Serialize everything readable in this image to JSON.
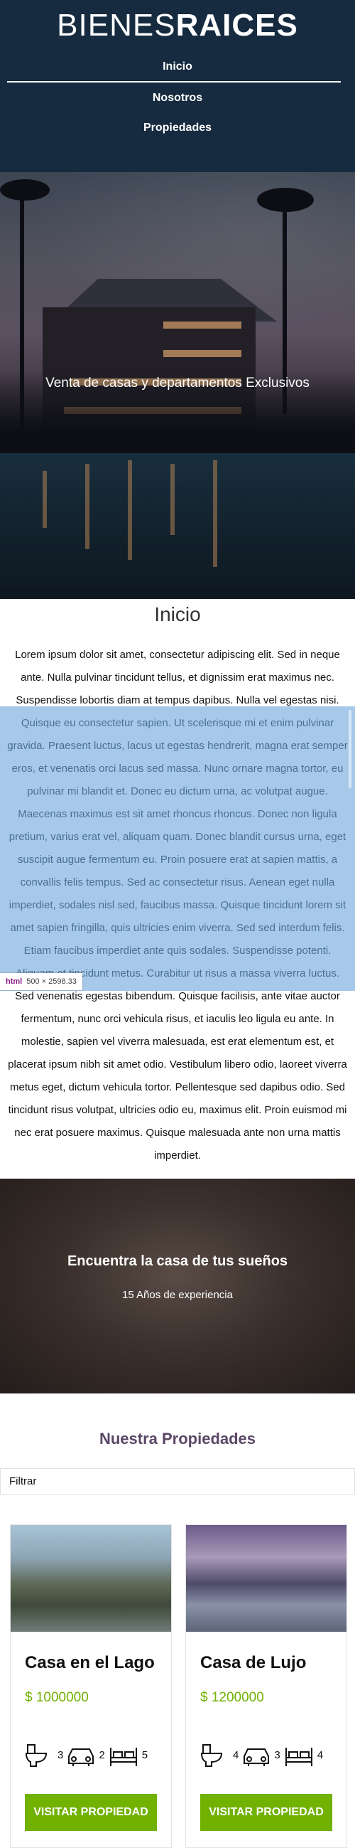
{
  "header": {
    "logo_light": "BIENES",
    "logo_bold": "RAICES",
    "nav": [
      "Inicio",
      "Nosotros",
      "Propiedades"
    ]
  },
  "hero": {
    "title": "Venta de casas y departamentos Exclusivos"
  },
  "inicio": {
    "title": "Inicio",
    "body": "Lorem ipsum dolor sit amet, consectetur adipiscing elit. Sed in neque ante. Nulla pulvinar tincidunt tellus, et dignissim erat maximus nec. Suspendisse lobortis diam at tempus dapibus. Nulla vel egestas nisi. Quisque eu consectetur sapien. Ut scelerisque mi et enim pulvinar gravida. Praesent luctus, lacus ut egestas hendrerit, magna erat semper eros, et venenatis orci lacus sed massa. Nunc ornare magna tortor, eu pulvinar mi blandit et. Donec eu dictum urna, ac volutpat augue. Maecenas maximus est sit amet rhoncus rhoncus. Donec non ligula pretium, varius erat vel, aliquam quam. Donec blandit cursus urna, eget suscipit augue fermentum eu. Proin posuere erat at sapien mattis, a convallis felis tempus. Sed ac consectetur risus. Aenean eget nulla imperdiet, sodales nisl sed, faucibus massa. Quisque tincidunt lorem sit amet sapien fringilla, quis ultricies enim viverra. Sed sed interdum felis. Etiam faucibus imperdiet ante quis sodales. Suspendisse potenti. Aliquam et tincidunt metus. Curabitur ut risus a massa viverra luctus. Sed venenatis egestas bibendum. Quisque facilisis, ante vitae auctor fermentum, nunc orci vehicula risus, et iaculis leo ligula eu ante. In molestie, sapien vel viverra malesuada, est erat elementum est, et placerat ipsum nibh sit amet odio. Vestibulum libero odio, laoreet viverra metus eget, dictum vehicula tortor. Pellentesque sed dapibus odio. Sed tincidunt risus volutpat, ultricies odio eu, maximus elit. Proin euismod mi nec erat posuere maximus. Quisque malesuada ante non urna mattis imperdiet."
  },
  "dev_badge": {
    "tag": "html",
    "size": "500 × 2598.33"
  },
  "banner": {
    "title": "Encuentra la casa de tus sueños",
    "subtitle": "15 Años de experiencia"
  },
  "properties": {
    "title": "Nuestra Propiedades",
    "filter_label": "Filtrar",
    "button_label": "VISITAR PROPIEDAD",
    "items": [
      {
        "name": "Casa en el Lago",
        "price": "$ 1000000",
        "toilets": "3",
        "parking": "2",
        "bedrooms": "5"
      },
      {
        "name": "Casa de Lujo",
        "price": "$ 1200000",
        "toilets": "4",
        "parking": "3",
        "bedrooms": "4"
      }
    ]
  },
  "colors": {
    "header_bg": "#162b3f",
    "accent_green": "#71b100",
    "selection_blue": "#6fa8dc"
  }
}
